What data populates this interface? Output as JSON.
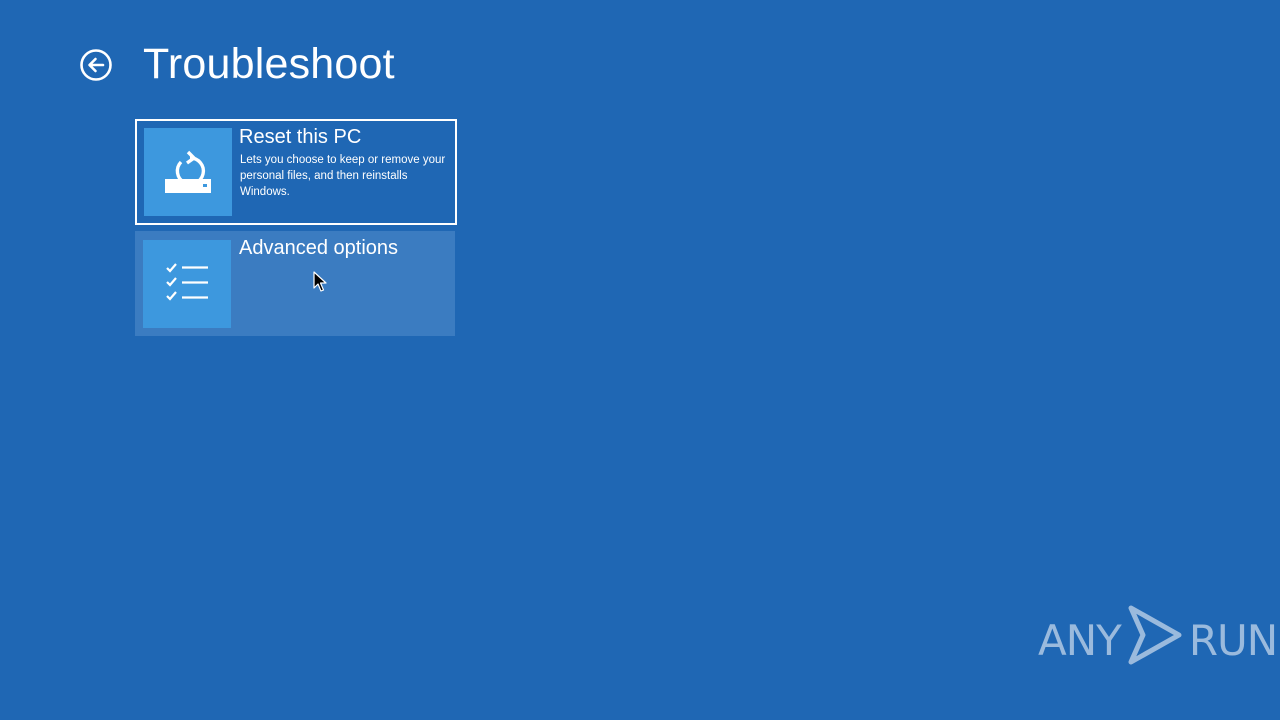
{
  "page": {
    "title": "Troubleshoot",
    "back_icon": "back-arrow-circle-icon"
  },
  "tiles": [
    {
      "title": "Reset this PC",
      "description": "Lets you choose to keep or remove your personal files, and then reinstalls Windows.",
      "icon": "reset-pc-icon",
      "selected": true
    },
    {
      "title": "Advanced options",
      "description": "",
      "icon": "checklist-icon",
      "hovered": true
    }
  ],
  "watermark": {
    "left_text": "ANY",
    "right_text": "RUN",
    "icon": "play-triangle-icon"
  },
  "colors": {
    "background": "#1f67b4",
    "tile_icon_bg": "#3d98de",
    "tile_hover_bg": "#3b7cc1",
    "foreground": "#ffffff"
  }
}
